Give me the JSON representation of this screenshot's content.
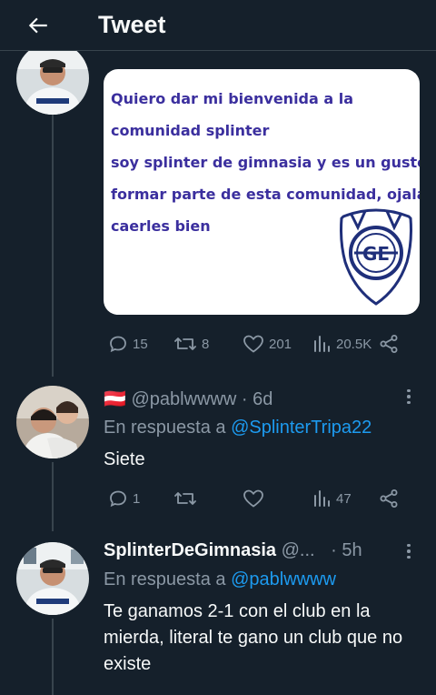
{
  "header": {
    "title": "Tweet"
  },
  "tweet1": {
    "media_lines": [
      "Quiero dar mi bienvenida a la",
      "comunidad splinter",
      "soy splinter de gimnasia y es un gusto",
      "formar parte de esta comunidad, ojalá",
      "caerles bien"
    ],
    "crest_text": "GE",
    "replies": "15",
    "retweets": "8",
    "likes": "201",
    "views": "20.5K"
  },
  "tweet2": {
    "flag": "🇦🇹",
    "handle": "@pablwwww",
    "time": "· 6d",
    "reply_prefix": "En respuesta a",
    "reply_to": "@SplinterTripa22",
    "text": "Siete",
    "replies": "1",
    "retweets": "",
    "likes": "",
    "views": "47"
  },
  "tweet3": {
    "name": "SplinterDeGimnasia",
    "handle": "@...",
    "time": "· 5h",
    "reply_prefix": "En respuesta a",
    "reply_to": "@pablwwww",
    "text": "Te ganamos 2-1 con el club en la mierda, literal te gano un club que no existe"
  },
  "colors": {
    "background": "#15202b",
    "accent": "#1d9bf0",
    "muted": "#8b98a5",
    "media_text": "#3b2f9e"
  }
}
